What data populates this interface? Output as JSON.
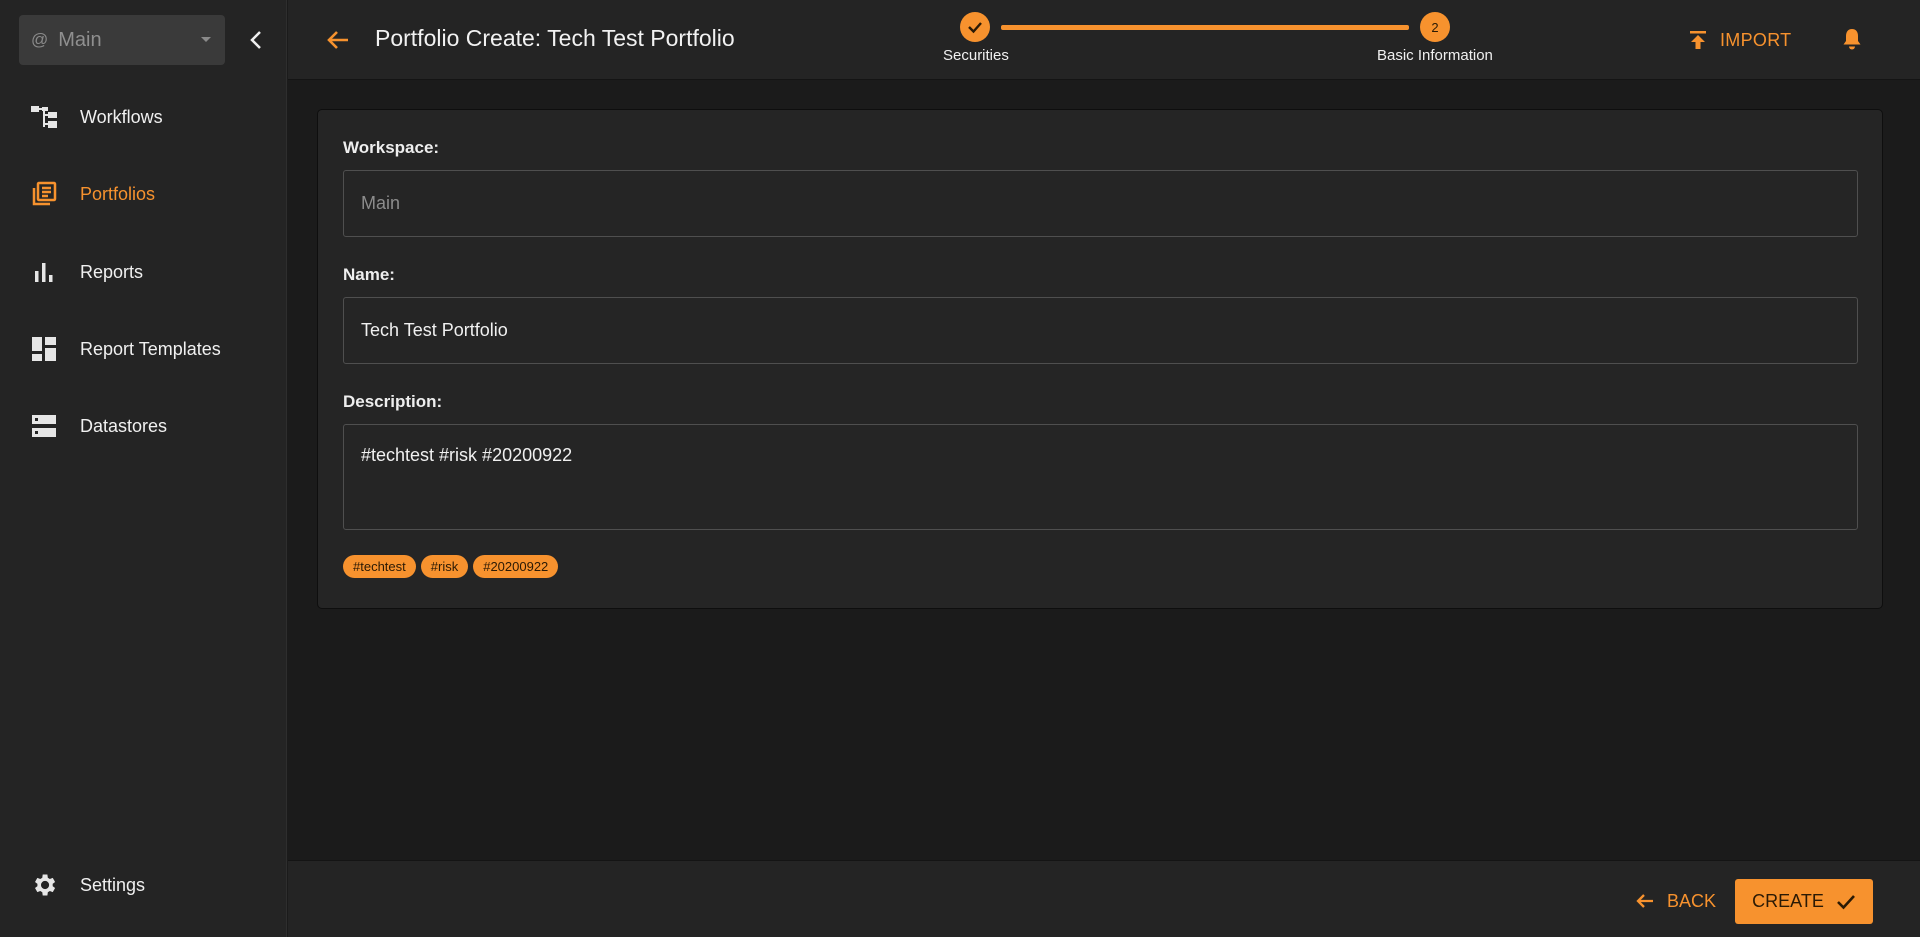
{
  "sidebar": {
    "workspace_prefix": "@",
    "workspace_value": "Main",
    "items": [
      {
        "label": "Workflows",
        "icon": "workflow-icon"
      },
      {
        "label": "Portfolios",
        "icon": "portfolio-icon",
        "active": true
      },
      {
        "label": "Reports",
        "icon": "bar-chart-icon"
      },
      {
        "label": "Report Templates",
        "icon": "dashboard-icon"
      },
      {
        "label": "Datastores",
        "icon": "storage-icon"
      }
    ],
    "settings_label": "Settings"
  },
  "header": {
    "title": "Portfolio Create: Tech Test Portfolio",
    "steps": [
      {
        "label": "Securities",
        "state": "complete"
      },
      {
        "label": "Basic Information",
        "number": "2",
        "state": "current"
      }
    ],
    "import_label": "IMPORT"
  },
  "form": {
    "workspace_label": "Workspace:",
    "workspace_value": "Main",
    "name_label": "Name:",
    "name_value": "Tech Test Portfolio",
    "description_label": "Description:",
    "description_value": "#techtest #risk #20200922",
    "tags": [
      "#techtest",
      "#risk",
      "#20200922"
    ]
  },
  "footer": {
    "back_label": "BACK",
    "create_label": "CREATE"
  },
  "colors": {
    "accent": "#f7922e",
    "background": "#1b1b1b",
    "panel": "#242424"
  }
}
